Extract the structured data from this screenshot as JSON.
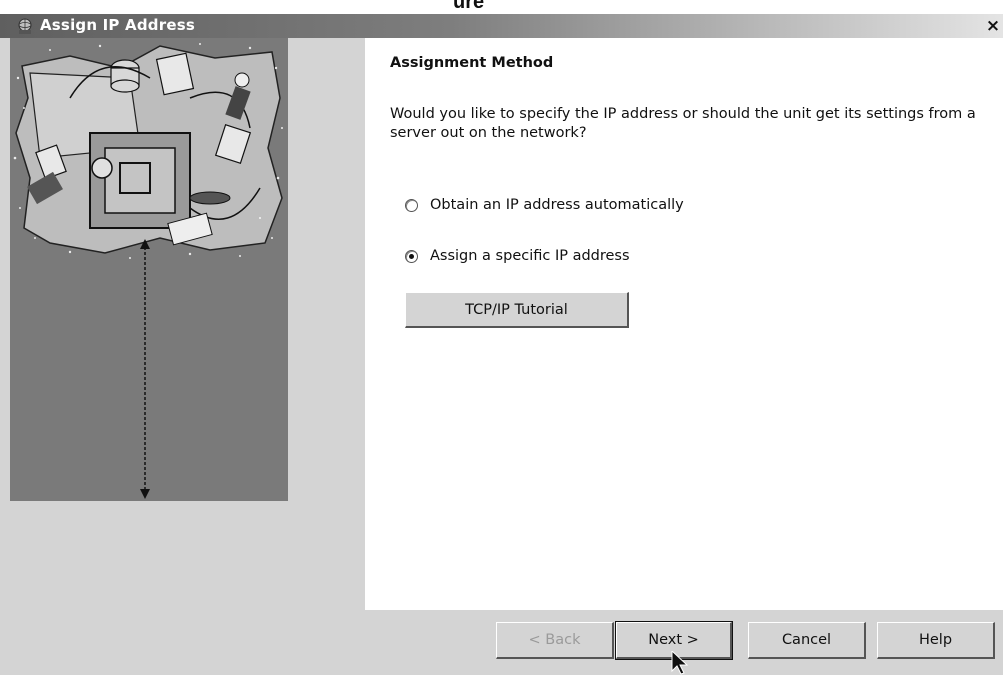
{
  "header_cut_text": "ure",
  "window": {
    "title": "Assign IP Address",
    "close_glyph": "×",
    "icon": "network-wizard-icon"
  },
  "content": {
    "heading": "Assignment Method",
    "question": "Would you like to specify the IP address or should the unit get its settings from a server out on the network?",
    "options": [
      {
        "label": "Obtain an IP address automatically",
        "selected": false
      },
      {
        "label": "Assign a specific IP address",
        "selected": true
      }
    ],
    "tutorial_button": "TCP/IP Tutorial"
  },
  "buttons": {
    "back": "< Back",
    "next": "Next >",
    "cancel": "Cancel",
    "help": "Help"
  }
}
